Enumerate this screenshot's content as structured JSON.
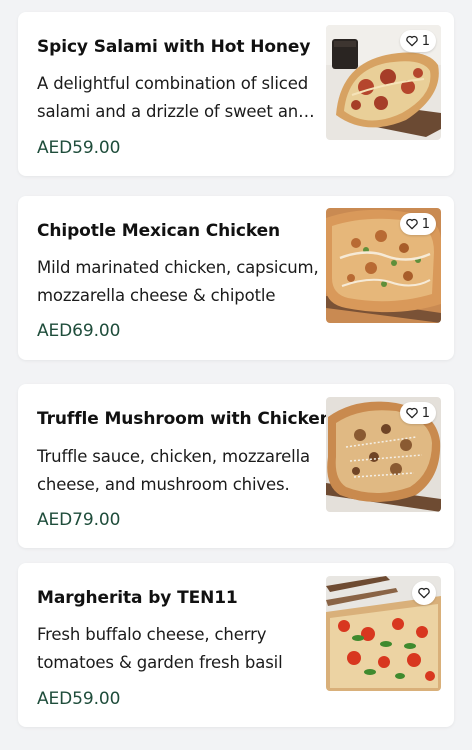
{
  "menu": {
    "items": [
      {
        "name": "Spicy Salami with Hot Honey",
        "description": "A delightful combination of sliced salami and a drizzle of sweet and spicy hot honey",
        "price": "AED59.00",
        "favorite_count": "1",
        "image_icon": "pizza-salami-photo"
      },
      {
        "name": "Chipotle Mexican Chicken",
        "description": "Mild marinated chicken, capsicum, mozzarella cheese & chipotle",
        "price": "AED69.00",
        "favorite_count": "1",
        "image_icon": "pizza-chipotle-photo"
      },
      {
        "name": "Truffle Mushroom with Chicken",
        "description": "Truffle sauce, chicken, mozzarella cheese, and mushroom chives.",
        "price": "AED79.00",
        "favorite_count": "1",
        "image_icon": "pizza-truffle-photo"
      },
      {
        "name": "Margherita by TEN11",
        "description": "Fresh buffalo cheese, cherry tomatoes & garden fresh basil",
        "price": "AED59.00",
        "favorite_count": "",
        "image_icon": "pizza-margherita-photo"
      }
    ]
  },
  "colors": {
    "background": "#f2f3f5",
    "card": "#ffffff",
    "price": "#1f4d3b",
    "favorite_icon": "heart-outline-icon"
  }
}
